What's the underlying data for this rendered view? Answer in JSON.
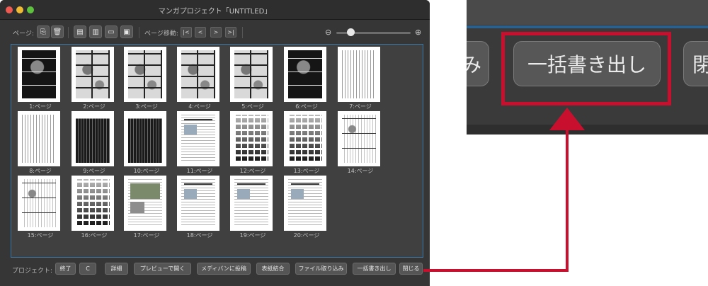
{
  "window": {
    "title": "マンガプロジェクト「UNTITLED」"
  },
  "toolbar": {
    "page_label": "ページ:",
    "page_move_label": "ページ移動:",
    "icons": [
      "new-page-icon",
      "trash-icon",
      "page-settings-icon",
      "spread-icon",
      "folder-open-icon",
      "folder-image-icon"
    ],
    "nav": [
      "|<",
      "<",
      ">",
      ">|"
    ],
    "zoom_out_glyph": "⊖",
    "zoom_in_glyph": "⊕"
  },
  "pages": [
    {
      "label": "1:ページ",
      "kind": "dark"
    },
    {
      "label": "2:ページ",
      "kind": "manga"
    },
    {
      "label": "3:ページ",
      "kind": "manga"
    },
    {
      "label": "4:ページ",
      "kind": "manga"
    },
    {
      "label": "5:ページ",
      "kind": "manga"
    },
    {
      "label": "6:ページ",
      "kind": "dark"
    },
    {
      "label": "7:ページ",
      "kind": "text"
    },
    {
      "label": "8:ページ",
      "kind": "text"
    },
    {
      "label": "9:ページ",
      "kind": "darktext"
    },
    {
      "label": "10:ページ",
      "kind": "darktext"
    },
    {
      "label": "11:ページ",
      "kind": "doc"
    },
    {
      "label": "12:ページ",
      "kind": "swatch"
    },
    {
      "label": "13:ページ",
      "kind": "swatch"
    },
    {
      "label": "14:ページ",
      "kind": "mixed"
    },
    {
      "label": "15:ページ",
      "kind": "mixed"
    },
    {
      "label": "16:ページ",
      "kind": "swatch"
    },
    {
      "label": "17:ページ",
      "kind": "photo"
    },
    {
      "label": "18:ページ",
      "kind": "doc"
    },
    {
      "label": "19:ページ",
      "kind": "doc"
    },
    {
      "label": "20:ページ",
      "kind": "doc"
    }
  ],
  "bottombar": {
    "project_label": "プロジェクト:",
    "buttons": [
      "終了",
      "C",
      "詳細",
      "プレビューで開く",
      "メディバンに投稿",
      "表紙結合",
      "ファイル取り込み",
      "一括書き出し",
      "閉じる"
    ]
  },
  "callout": {
    "left_partial": "み",
    "main": "一括書き出し",
    "right_partial": "閉",
    "highlight_color": "#c8102e"
  }
}
